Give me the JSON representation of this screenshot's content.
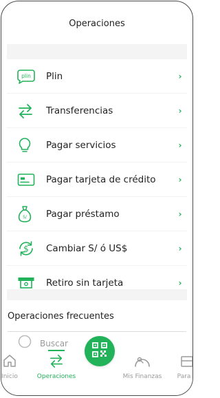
{
  "header": {
    "title": "Operaciones"
  },
  "menu": [
    {
      "label": "Plin",
      "icon": "plin-icon"
    },
    {
      "label": "Transferencias",
      "icon": "transfer-arrows-icon"
    },
    {
      "label": "Pagar servicios",
      "icon": "lightbulb-icon"
    },
    {
      "label": "Pagar tarjeta de crédito",
      "icon": "credit-card-icon"
    },
    {
      "label": "Pagar préstamo",
      "icon": "money-bag-icon"
    },
    {
      "label": "Cambiar S/ ó US$",
      "icon": "currency-exchange-icon"
    },
    {
      "label": "Retiro sin tarjeta",
      "icon": "cash-withdrawal-icon"
    }
  ],
  "frequent": {
    "title": "Operaciones frecuentes",
    "search_placeholder": "Buscar"
  },
  "nav": {
    "inicio": "Inicio",
    "operaciones": "Operaciones",
    "mis_finanzas": "Mis Finanzas",
    "para_ti": "Para ti"
  },
  "icons": {
    "plin_text": "plin"
  },
  "colors": {
    "accent": "#21b25a",
    "text": "#222222",
    "muted": "#9a9a9a"
  }
}
